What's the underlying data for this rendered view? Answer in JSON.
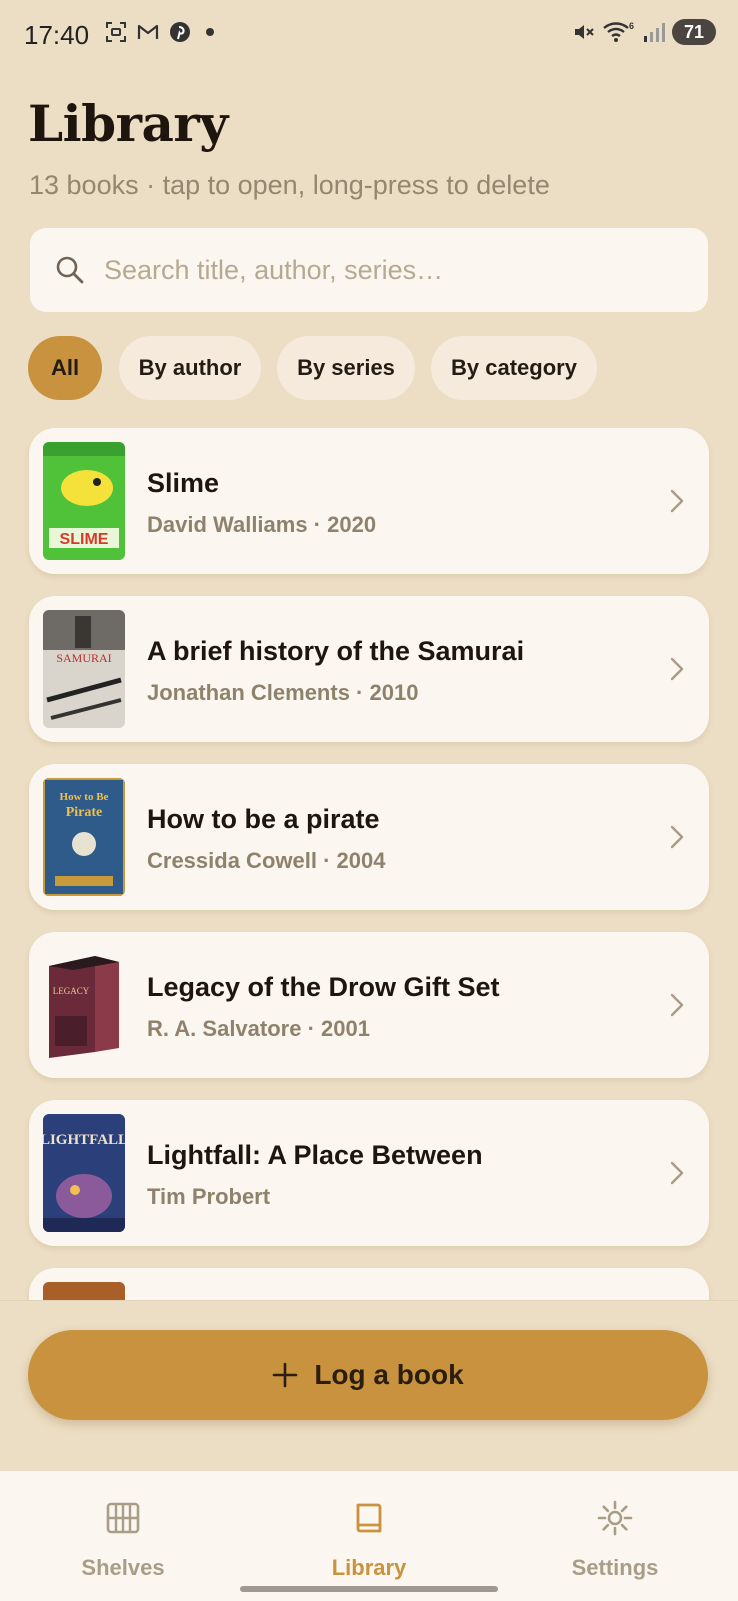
{
  "status_bar": {
    "time": "17:40",
    "left_icons": [
      "screenshot-icon",
      "gmail-icon",
      "pinterest-icon",
      "dot-icon"
    ],
    "right_icons": [
      "mute-icon",
      "wifi-icon",
      "signal-icon"
    ],
    "wifi_badge": "6",
    "battery": "71"
  },
  "header": {
    "title": "Library",
    "subtitle": "13 books · tap to open, long-press to delete"
  },
  "search": {
    "placeholder": "Search title, author, series…",
    "value": ""
  },
  "filters": [
    {
      "label": "All",
      "active": true
    },
    {
      "label": "By author",
      "active": false
    },
    {
      "label": "By series",
      "active": false
    },
    {
      "label": "By category",
      "active": false
    }
  ],
  "books": [
    {
      "title": "Slime",
      "meta": "David Walliams · 2020",
      "cover_color": "#4fc23a"
    },
    {
      "title": "A brief history of the Samurai",
      "meta": "Jonathan Clements · 2010",
      "cover_color": "#d9d4cc"
    },
    {
      "title": "How to be a pirate",
      "meta": "Cressida Cowell · 2004",
      "cover_color": "#2f5b8a"
    },
    {
      "title": "Legacy of the Drow Gift Set",
      "meta": "R. A. Salvatore · 2001",
      "cover_color": "#6a2a3a"
    },
    {
      "title": "Lightfall: A Place Between",
      "meta": "Tim Probert",
      "cover_color": "#2b3f7a"
    },
    {
      "title": "",
      "meta": "",
      "cover_color": "#c07a3a"
    }
  ],
  "cta": {
    "label": "Log a book",
    "icon": "plus-icon"
  },
  "nav": [
    {
      "label": "Shelves",
      "icon": "shelves-icon",
      "active": false
    },
    {
      "label": "Library",
      "icon": "book-icon",
      "active": true
    },
    {
      "label": "Settings",
      "icon": "gear-icon",
      "active": false
    }
  ],
  "colors": {
    "background": "#ecdec4",
    "card": "#fbf7f0",
    "accent": "#c8923e",
    "muted_text": "#8f826c"
  }
}
